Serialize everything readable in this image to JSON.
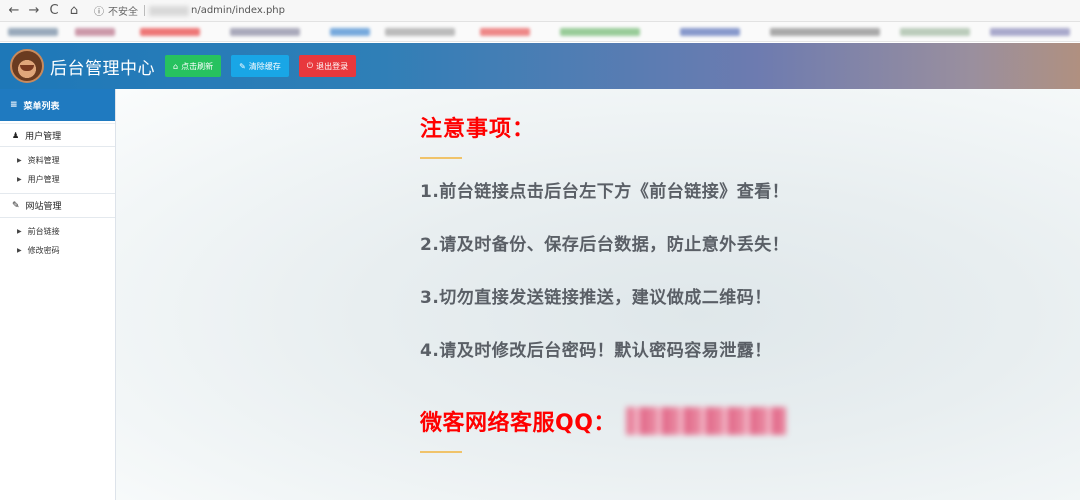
{
  "browser": {
    "back_icon": "←",
    "forward_icon": "→",
    "reload_icon": "C",
    "home_icon": "⌂",
    "info_icon": "ⓘ",
    "insecure_label": "不安全",
    "url_path": "n/admin/index.php"
  },
  "header": {
    "title": "后台管理中心",
    "buttons": [
      {
        "label": "点击刷新",
        "icon": "⌂",
        "color": "#27c25f"
      },
      {
        "label": "清除缓存",
        "icon": "✎",
        "color": "#19a6e6"
      },
      {
        "label": "退出登录",
        "icon": "⏻",
        "color": "#e8383d"
      }
    ]
  },
  "sidebar": {
    "menu_title": "菜单列表",
    "menu_icon": "≡",
    "groups": [
      {
        "title": "用户管理",
        "icon": "👤",
        "items": [
          "资料管理",
          "用户管理"
        ]
      },
      {
        "title": "网站管理",
        "icon": "✎",
        "items": [
          "前台链接",
          "修改密码"
        ]
      }
    ]
  },
  "main": {
    "notice_title": "注意事项：",
    "items": [
      "1.前台链接点击后台左下方《前台链接》查看！",
      "2.请及时备份、保存后台数据，防止意外丢失！",
      "3.切勿直接发送链接推送，建议做成二维码！",
      "4.请及时修改后台密码！默认密码容易泄露！"
    ],
    "qq_label": "微客网络客服QQ："
  },
  "colors": {
    "accent_red": "#ff0000",
    "gold": "#f0c36a",
    "sidebar_head": "#1f7ac0"
  }
}
